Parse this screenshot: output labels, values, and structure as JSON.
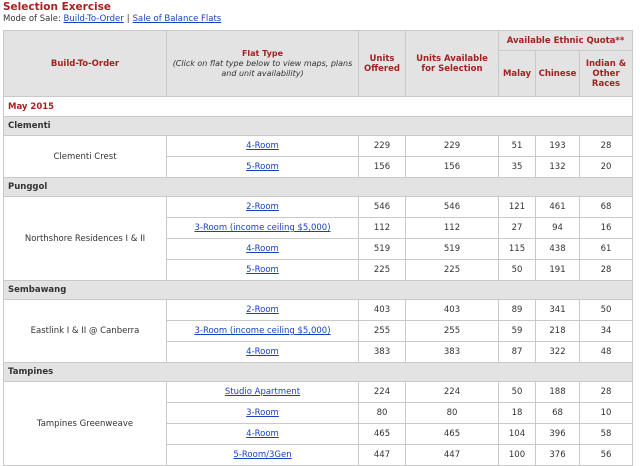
{
  "page": {
    "title": "Selection Exercise",
    "mode_label": "Mode of Sale:",
    "mode_links": [
      "Build-To-Order",
      "Sale of Balance Flats"
    ],
    "mode_separator": "|"
  },
  "table": {
    "headers": {
      "project": "Build-To-Order",
      "flat_type": "Flat Type",
      "flat_type_note": "(Click on flat type below to view maps, plans and unit availability)",
      "units_offered": "Units Offered",
      "units_available": "Units Available for Selection",
      "ethnic_quota": "Available Ethnic Quota**",
      "malay": "Malay",
      "chinese": "Chinese",
      "indian_other": "Indian & Other Races"
    },
    "month": "May 2015",
    "towns": [
      {
        "name": "Clementi",
        "projects": [
          {
            "name": "Clementi Crest",
            "rows": [
              {
                "flat_type": "4-Room",
                "offered": "229",
                "available": "229",
                "malay": "51",
                "chinese": "193",
                "indian_other": "28"
              },
              {
                "flat_type": "5-Room",
                "offered": "156",
                "available": "156",
                "malay": "35",
                "chinese": "132",
                "indian_other": "20"
              }
            ]
          }
        ]
      },
      {
        "name": "Punggol",
        "projects": [
          {
            "name": "Northshore Residences I & II",
            "rows": [
              {
                "flat_type": "2-Room",
                "offered": "546",
                "available": "546",
                "malay": "121",
                "chinese": "461",
                "indian_other": "68"
              },
              {
                "flat_type": "3-Room (income ceiling $5,000)",
                "offered": "112",
                "available": "112",
                "malay": "27",
                "chinese": "94",
                "indian_other": "16"
              },
              {
                "flat_type": "4-Room",
                "offered": "519",
                "available": "519",
                "malay": "115",
                "chinese": "438",
                "indian_other": "61"
              },
              {
                "flat_type": "5-Room",
                "offered": "225",
                "available": "225",
                "malay": "50",
                "chinese": "191",
                "indian_other": "28"
              }
            ]
          }
        ]
      },
      {
        "name": "Sembawang",
        "projects": [
          {
            "name": "Eastlink I & II @ Canberra",
            "rows": [
              {
                "flat_type": "2-Room",
                "offered": "403",
                "available": "403",
                "malay": "89",
                "chinese": "341",
                "indian_other": "50"
              },
              {
                "flat_type": "3-Room (income ceiling $5,000)",
                "offered": "255",
                "available": "255",
                "malay": "59",
                "chinese": "218",
                "indian_other": "34"
              },
              {
                "flat_type": "4-Room",
                "offered": "383",
                "available": "383",
                "malay": "87",
                "chinese": "322",
                "indian_other": "48"
              }
            ]
          }
        ]
      },
      {
        "name": "Tampines",
        "projects": [
          {
            "name": "Tampines Greenweave",
            "rows": [
              {
                "flat_type": "Studio Apartment",
                "offered": "224",
                "available": "224",
                "malay": "50",
                "chinese": "188",
                "indian_other": "28"
              },
              {
                "flat_type": "3-Room",
                "offered": "80",
                "available": "80",
                "malay": "18",
                "chinese": "68",
                "indian_other": "10"
              },
              {
                "flat_type": "4-Room",
                "offered": "465",
                "available": "465",
                "malay": "104",
                "chinese": "396",
                "indian_other": "58"
              },
              {
                "flat_type": "5-Room/3Gen",
                "offered": "447",
                "available": "447",
                "malay": "100",
                "chinese": "376",
                "indian_other": "56"
              }
            ]
          }
        ]
      }
    ]
  },
  "colors": {
    "title_red": "#a32222",
    "link_blue": "#1a3fbf",
    "header_bg": "#e3e3e3",
    "border": "#c9c9c9"
  }
}
